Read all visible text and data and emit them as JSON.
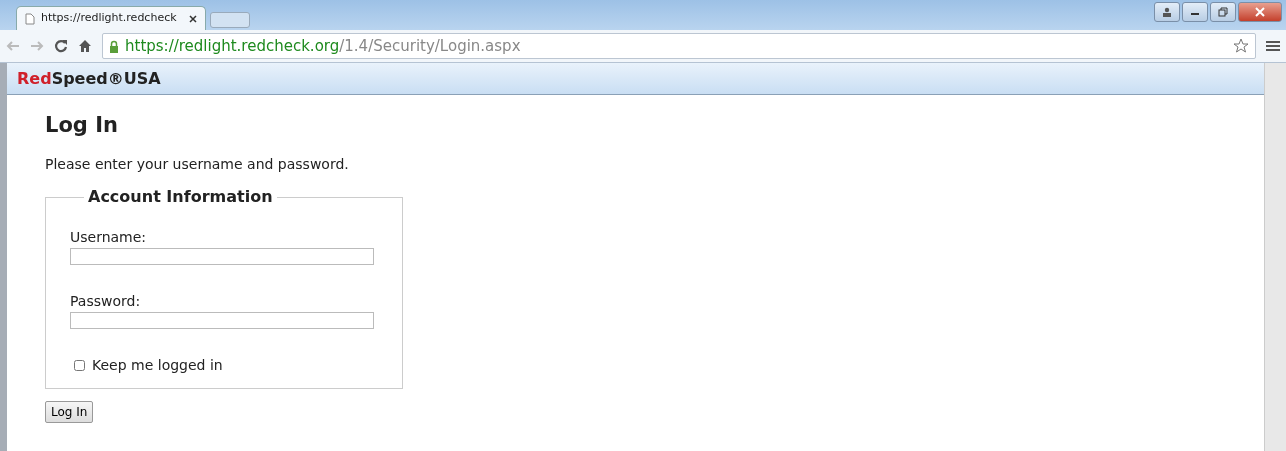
{
  "browser": {
    "tab": {
      "title": "https://redlight.redcheck",
      "selected": true
    },
    "address": {
      "scheme": "https://",
      "host": "redlight.redcheck.org",
      "path": "/1.4/Security/Login.aspx",
      "secure": true
    }
  },
  "site_header": {
    "logo": [
      {
        "text": "Red",
        "kind": "accent"
      },
      {
        "text": "Speed®USA",
        "kind": "plain"
      }
    ]
  },
  "page": {
    "title": "Log In",
    "intro": "Please enter your username and password.",
    "fieldset": {
      "legend": "Account Information",
      "fields": [
        {
          "label": "Username:"
        },
        {
          "label": "Password:"
        }
      ],
      "remember": {
        "label": "Keep me logged in",
        "checked": false
      }
    },
    "submit": "Log In"
  }
}
